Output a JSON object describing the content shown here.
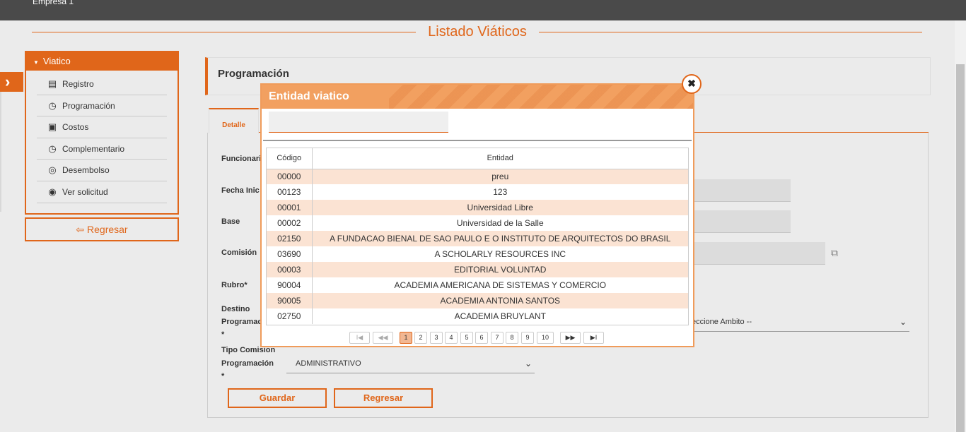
{
  "topbar": {
    "company": "Empresa 1"
  },
  "page": {
    "title": "Listado Viáticos"
  },
  "sidebar": {
    "header": "Viatico",
    "items": [
      {
        "label": "Registro",
        "icon": "list-icon"
      },
      {
        "label": "Programación",
        "icon": "clock-icon"
      },
      {
        "label": "Costos",
        "icon": "money-icon"
      },
      {
        "label": "Complementario",
        "icon": "clock-icon"
      },
      {
        "label": "Desembolso",
        "icon": "coins-icon"
      },
      {
        "label": "Ver solicitud",
        "icon": "eye-icon"
      }
    ],
    "back_label": "Regresar"
  },
  "section": {
    "title": "Programación"
  },
  "tabs": {
    "detalle": "Detalle"
  },
  "form": {
    "funcionario_label": "Funcionari",
    "fecha_label": "Fecha Inic",
    "base_label": "Base",
    "comision_label": "Comisión",
    "rubro_label": "Rubro*",
    "destino_label_1": "Destino",
    "destino_label_2": "Programac",
    "destino_label_3": "*",
    "tipo_label_1": "Tipo Comision",
    "tipo_label_2": "Programación",
    "tipo_label_3": "*",
    "ambito_value": "eccione Ambito --",
    "tipo_value": "ADMINISTRATIVO",
    "save_label": "Guardar",
    "back_label": "Regresar"
  },
  "modal": {
    "title": "Entidad viatico",
    "search_value": "",
    "columns": [
      "Código",
      "Entidad"
    ],
    "rows": [
      {
        "code": "00000",
        "name": "preu"
      },
      {
        "code": "00123",
        "name": "123"
      },
      {
        "code": "00001",
        "name": "Universidad Libre"
      },
      {
        "code": "00002",
        "name": "Universidad de la Salle"
      },
      {
        "code": "02150",
        "name": "A FUNDACAO BIENAL DE SAO PAULO E O INSTITUTO DE ARQUITECTOS DO BRASIL"
      },
      {
        "code": "03690",
        "name": "A SCHOLARLY RESOURCES INC"
      },
      {
        "code": "00003",
        "name": "EDITORIAL VOLUNTAD"
      },
      {
        "code": "90004",
        "name": "ACADEMIA AMERICANA DE SISTEMAS Y COMERCIO"
      },
      {
        "code": "90005",
        "name": "ACADEMIA ANTONIA SANTOS"
      },
      {
        "code": "02750",
        "name": "ACADEMIA BRUYLANT"
      }
    ],
    "pager": {
      "first": "I◀",
      "prev": "◀◀",
      "pages": [
        "1",
        "2",
        "3",
        "4",
        "5",
        "6",
        "7",
        "8",
        "9",
        "10"
      ],
      "current": "1",
      "next": "▶▶",
      "last": "▶I"
    }
  },
  "colors": {
    "accent": "#e0661a",
    "modal_header": "#f2a060",
    "row_alt": "#fbe3d3"
  }
}
